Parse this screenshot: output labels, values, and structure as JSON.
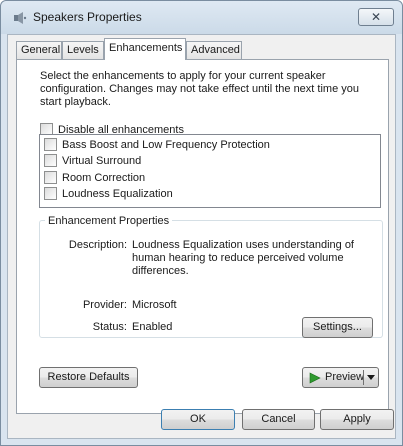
{
  "window": {
    "title": "Speakers Properties",
    "close_glyph": "✕"
  },
  "tabs": [
    {
      "label": "General",
      "active": false
    },
    {
      "label": "Levels",
      "active": false
    },
    {
      "label": "Enhancements",
      "active": true
    },
    {
      "label": "Advanced",
      "active": false
    }
  ],
  "enhancements": {
    "intro": "Select the enhancements to apply for your current speaker configuration. Changes may not take effect until the next time you start playback.",
    "disable_all_label": "Disable all enhancements",
    "items": [
      {
        "label": "Bass Boost and Low Frequency Protection",
        "checked": false
      },
      {
        "label": "Virtual Surround",
        "checked": false
      },
      {
        "label": "Room Correction",
        "checked": false
      },
      {
        "label": "Loudness Equalization",
        "checked": false
      }
    ]
  },
  "properties": {
    "group_label": "Enhancement Properties",
    "description_label": "Description:",
    "description_value": "Loudness Equalization uses understanding of human hearing to reduce perceived volume differences.",
    "provider_label": "Provider:",
    "provider_value": "Microsoft",
    "status_label": "Status:",
    "status_value": "Enabled",
    "settings_button": "Settings..."
  },
  "panel_buttons": {
    "restore_defaults": "Restore Defaults",
    "preview": "Preview"
  },
  "dialog_buttons": {
    "ok": "OK",
    "cancel": "Cancel",
    "apply": "Apply"
  },
  "colors": {
    "play_green": "#2f9a2f",
    "focus_border": "#3c7fb1"
  }
}
